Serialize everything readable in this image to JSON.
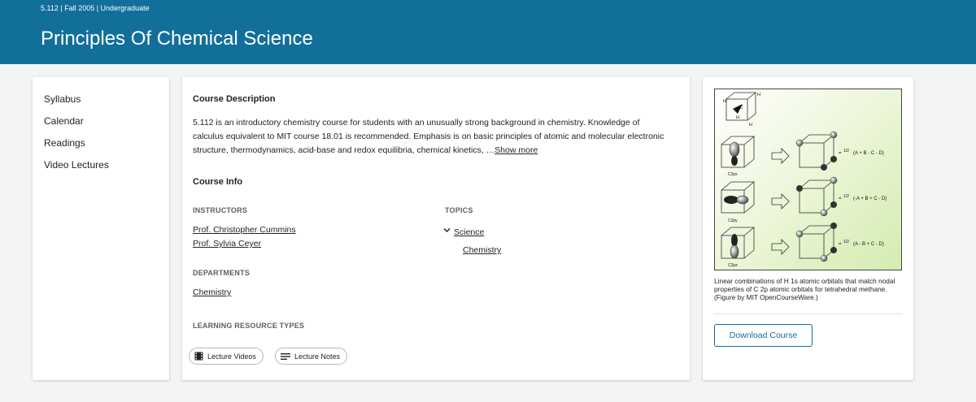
{
  "header": {
    "meta": "5.112 | Fall 2005 | Undergraduate",
    "title": "Principles Of Chemical Science"
  },
  "nav": {
    "items": [
      "Syllabus",
      "Calendar",
      "Readings",
      "Video Lectures"
    ]
  },
  "main": {
    "description_heading": "Course Description",
    "description": "5.112 is an introductory chemistry course for students with an unusually strong background in chemistry. Knowledge of calculus equivalent to MIT course 18.01 is recommended. Emphasis is on basic principles of atomic and molecular electronic structure, thermodynamics, acid-base and redox equilibria, chemical kinetics, …",
    "show_more": "Show more",
    "course_info_heading": "Course Info",
    "instructors_label": "INSTRUCTORS",
    "instructors": [
      "Prof. Christopher Cummins",
      "Prof. Sylvia Ceyer"
    ],
    "topics_label": "TOPICS",
    "topic": "Science",
    "subtopic": "Chemistry",
    "departments_label": "DEPARTMENTS",
    "department": "Chemistry",
    "resource_types_label": "LEARNING RESOURCE TYPES",
    "resource_types": [
      "Lecture Videos",
      "Lecture Notes"
    ]
  },
  "side": {
    "figure": {
      "h_labels": [
        "H",
        "H",
        "H",
        "H"
      ],
      "c_label": "C",
      "orbital_labels": [
        "C2px",
        "C2py",
        "C2pz"
      ],
      "fraction": "1/2",
      "combinations": [
        "(A + B - C - D)",
        "(-A + B + C - D)",
        "(A - B + C - D)"
      ]
    },
    "caption": "Linear combinations of H 1s atomic orbitals that match nodal properties of C 2p atomic orbitals for tetrahedral methane. (Figure by MIT OpenCourseWare.)",
    "download_label": "Download Course"
  }
}
